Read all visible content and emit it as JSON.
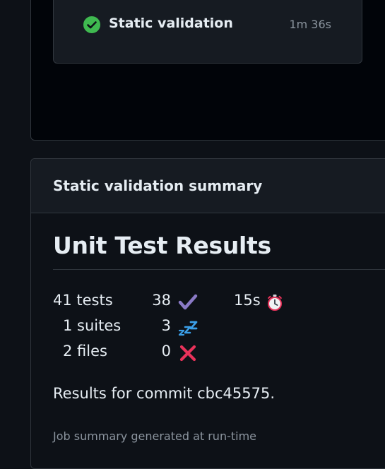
{
  "job": {
    "name": "Static validation",
    "duration": "1m 36s",
    "status": "success",
    "status_icon": "check-circle-icon",
    "status_color": "#3fb950"
  },
  "summary": {
    "title": "Static validation summary",
    "heading": "Unit Test Results",
    "stats": {
      "tests": "41 tests",
      "suites": "1 suites",
      "files": "2 files",
      "passed": "38",
      "skipped": "3",
      "failed": "0",
      "duration": "15s"
    },
    "icons": {
      "passed": "heavy-check-mark-icon",
      "skipped": "zzz-icon",
      "failed": "cross-mark-icon",
      "duration": "stopwatch-icon"
    },
    "commit_text": "Results for commit cbc45575.",
    "footer": "Job summary generated at run-time"
  },
  "colors": {
    "background": "#0d1117",
    "card": "#161b22",
    "border": "#30363d",
    "muted": "#8b949e",
    "success": "#3fb950",
    "failure": "#f85149"
  }
}
